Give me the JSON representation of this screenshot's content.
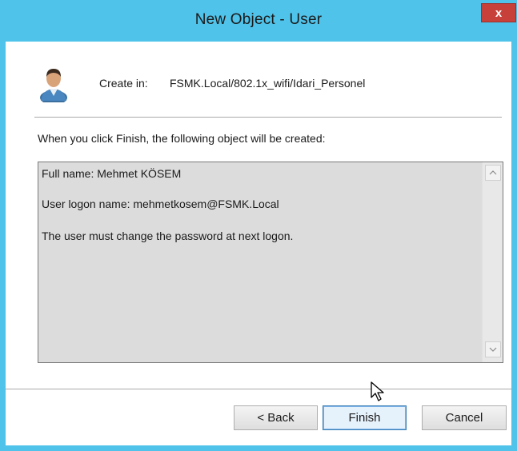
{
  "window": {
    "title": "New Object - User",
    "close_label": "x",
    "titlebar_color": "#4fc3ea",
    "close_color": "#c7403a"
  },
  "header": {
    "icon": "user-icon",
    "create_in_label": "Create in:",
    "create_in_path": "FSMK.Local/802.1x_wifi/Idari_Personel"
  },
  "intro_text": "When you click Finish, the following object will be created:",
  "summary": {
    "lines": [
      "Full name: Mehmet KÖSEM",
      "User logon name: mehmetkosem@FSMK.Local",
      "The user must change the password at next logon."
    ]
  },
  "buttons": {
    "back": "< Back",
    "finish": "Finish",
    "cancel": "Cancel"
  }
}
